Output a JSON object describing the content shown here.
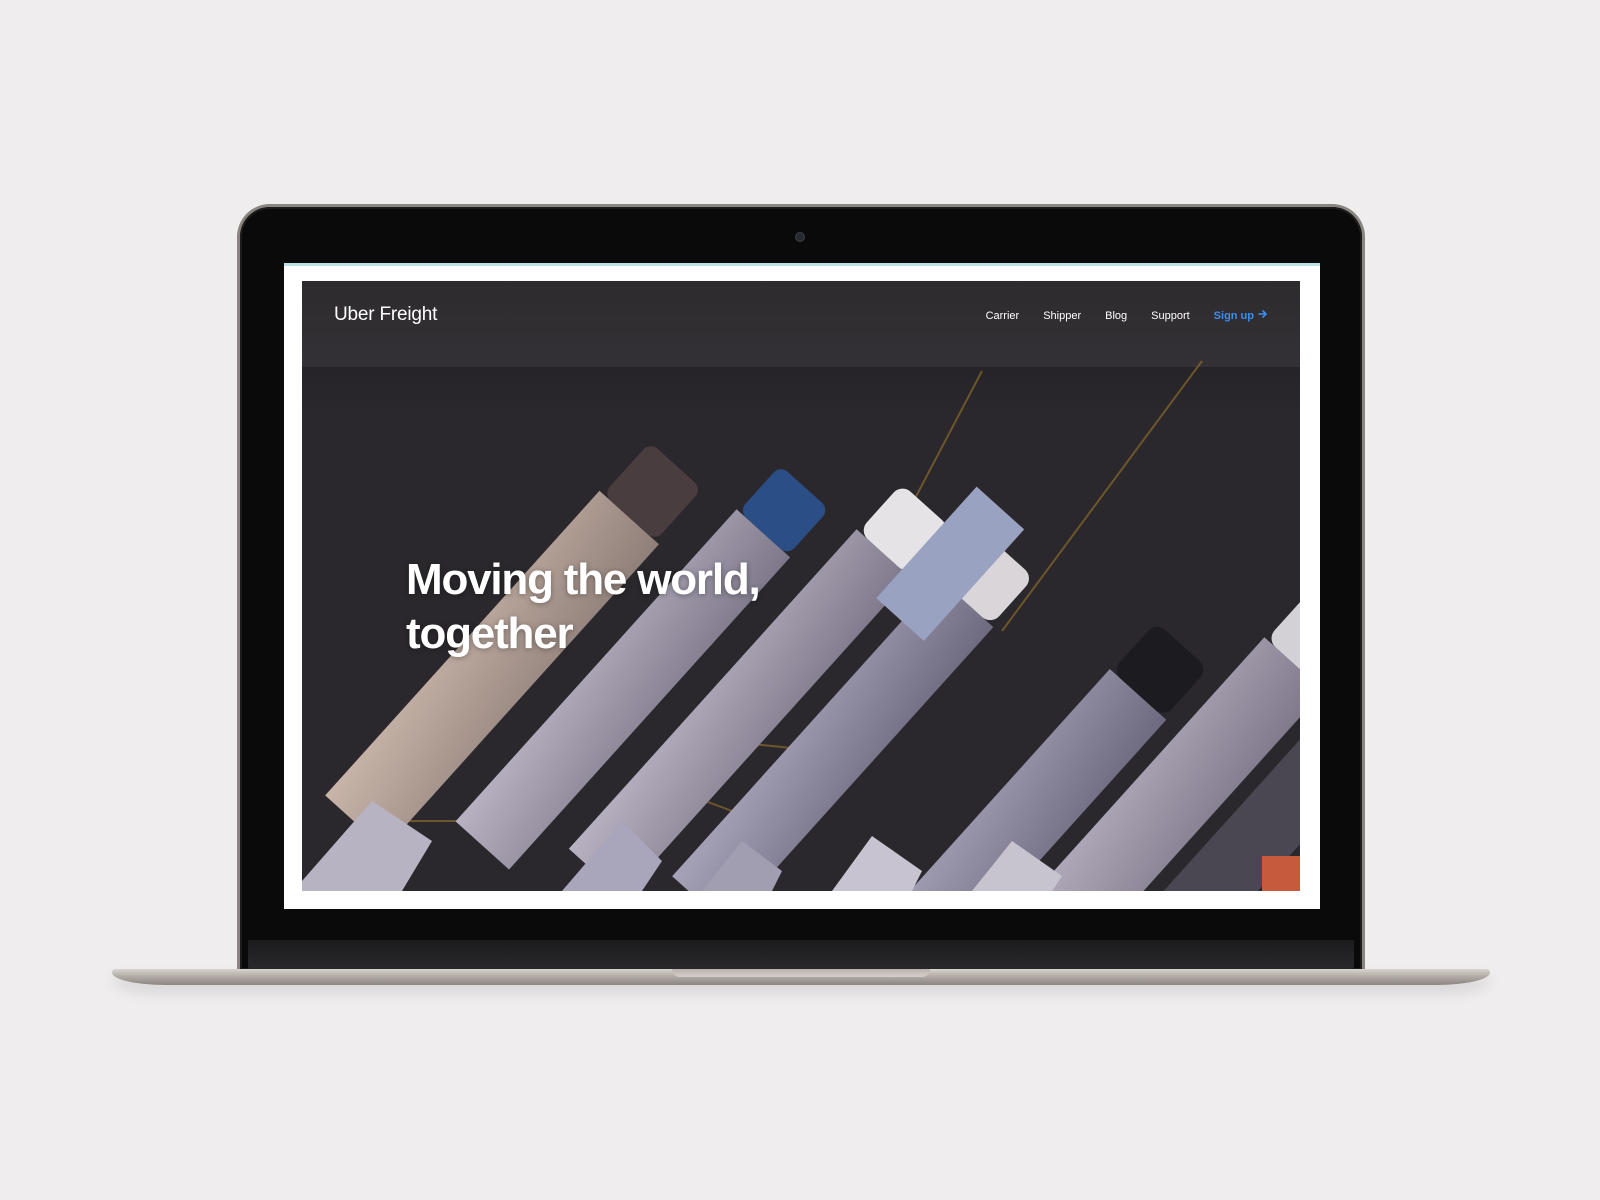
{
  "site": {
    "brand": "Uber Freight",
    "nav": {
      "links": [
        "Carrier",
        "Shipper",
        "Blog",
        "Support"
      ],
      "signup_label": "Sign up",
      "signup_color": "#3b8ef0"
    },
    "hero": {
      "headline_line1": "Moving the world,",
      "headline_line2": "together",
      "background_image": "aerial view of parked semi-truck trailers"
    }
  },
  "icons": {
    "signup_arrow": "arrow-right-icon",
    "camera": "camera-icon"
  }
}
